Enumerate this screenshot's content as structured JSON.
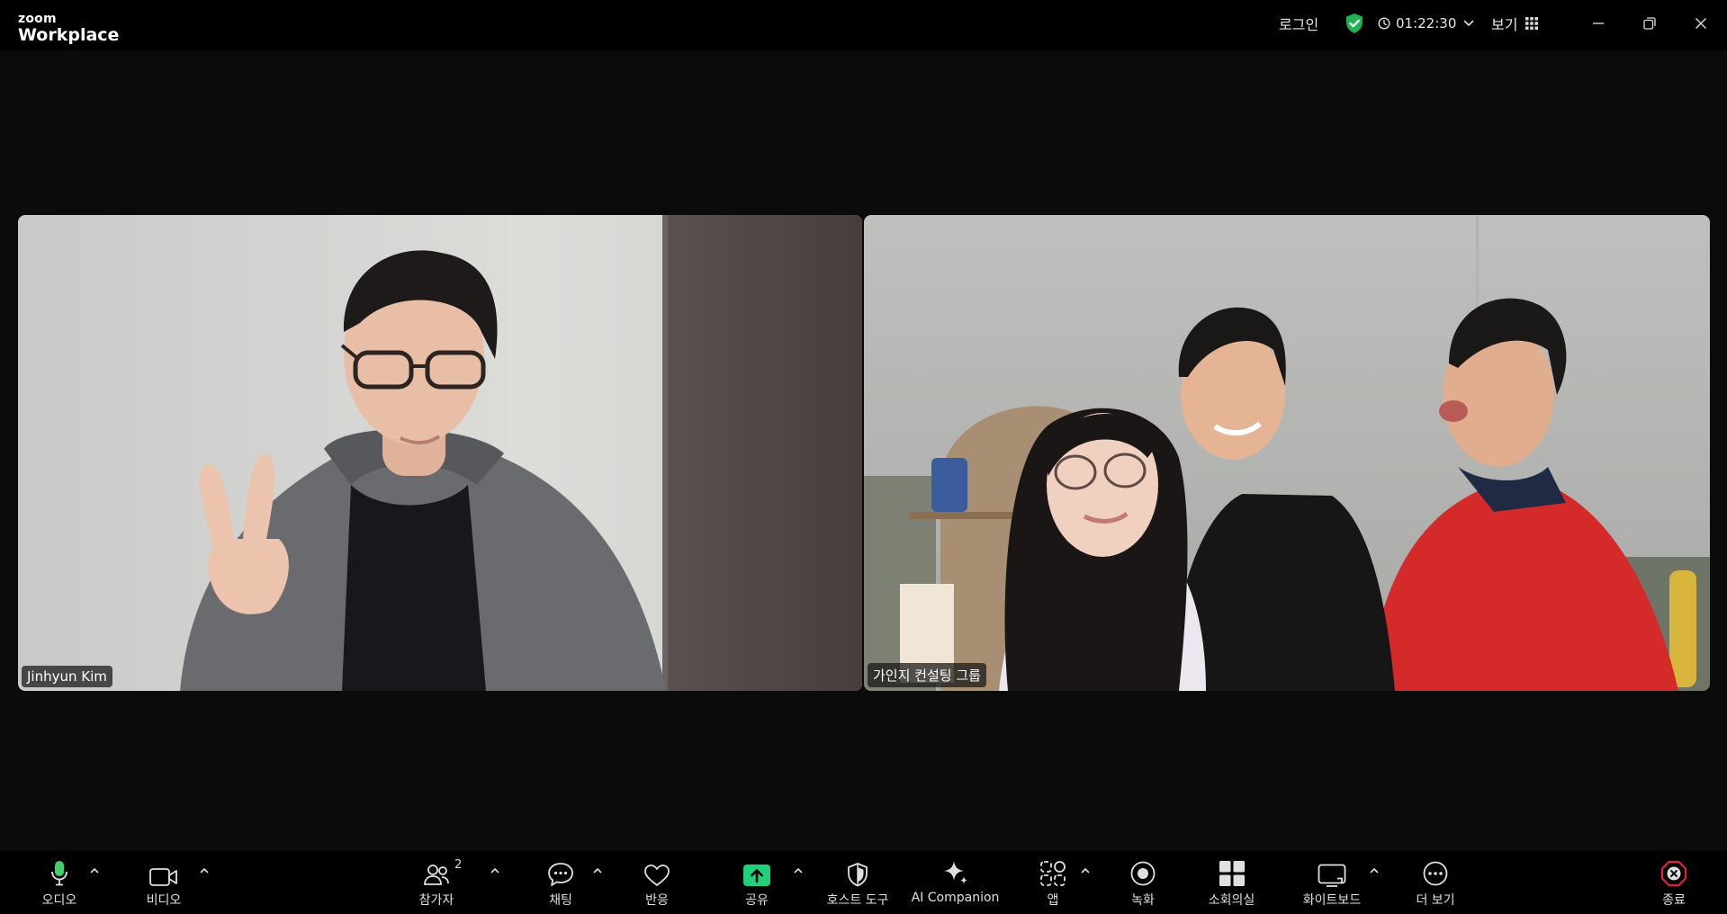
{
  "titlebar": {
    "brand_top": "zoom",
    "brand_main": "Workplace",
    "login": "로그인",
    "timer": "01:22:30",
    "view": "보기"
  },
  "participants": [
    {
      "name": "Jinhyun Kim"
    },
    {
      "name": "가인지 컨설팅 그룹"
    }
  ],
  "toolbar": {
    "audio": "오디오",
    "video": "비디오",
    "participants": "참가자",
    "participants_count": "2",
    "chat": "채팅",
    "reactions": "반응",
    "share": "공유",
    "host_tools": "호스트 도구",
    "ai_companion": "AI Companion",
    "apps": "앱",
    "record": "녹화",
    "breakout": "소회의실",
    "whiteboard": "화이트보드",
    "more": "더 보기",
    "end": "종료"
  },
  "colors": {
    "shield_green": "#21b352",
    "mic_green": "#3fd16b",
    "share_green": "#20d07a",
    "end_red": "#e0243e"
  },
  "icons": [
    "mic-icon",
    "video-camera-icon",
    "participants-icon",
    "chat-icon",
    "heart-icon",
    "share-arrow-icon",
    "shield-icon",
    "sparkle-icon",
    "apps-icon",
    "record-icon",
    "grid-icon",
    "whiteboard-icon",
    "more-dots-icon",
    "close-icon"
  ]
}
